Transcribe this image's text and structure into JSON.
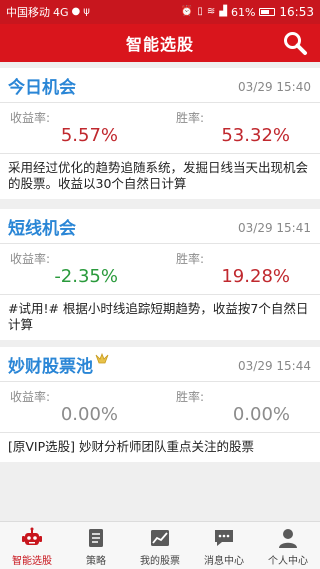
{
  "status_bar": {
    "carrier": "中国移动",
    "network": "4G",
    "battery": "61%",
    "time": "16:53"
  },
  "header": {
    "title": "智能选股",
    "search_icon": "search-icon"
  },
  "cards": [
    {
      "title": "今日机会",
      "time": "03/29 15:40",
      "return_label": "收益率:",
      "return_value": "5.57%",
      "winrate_label": "胜率:",
      "winrate_value": "53.32%",
      "description": "采用经过优化的趋势追随系统，发掘日线当天出现机会的股票。收益以30个自然日计算"
    },
    {
      "title": "短线机会",
      "time": "03/29 15:41",
      "return_label": "收益率:",
      "return_value": "-2.35%",
      "winrate_label": "胜率:",
      "winrate_value": "19.28%",
      "description": "#试用!# 根据小时线追踪短期趋势，收益按7个自然日计算"
    },
    {
      "title": "妙财股票池",
      "vip_icon": "vip-crown-icon",
      "time": "03/29 15:44",
      "return_label": "收益率:",
      "return_value": "0.00%",
      "winrate_label": "胜率:",
      "winrate_value": "0.00%",
      "description": "[原VIP选股] 妙财分析师团队重点关注的股票"
    }
  ],
  "tabs": [
    {
      "label": "智能选股",
      "icon": "robot-icon",
      "active": true
    },
    {
      "label": "策略",
      "icon": "document-icon",
      "active": false
    },
    {
      "label": "我的股票",
      "icon": "chart-icon",
      "active": false
    },
    {
      "label": "消息中心",
      "icon": "message-icon",
      "active": false
    },
    {
      "label": "个人中心",
      "icon": "person-icon",
      "active": false
    }
  ],
  "colors": {
    "brand_red": "#d9151c",
    "title_blue": "#2a86d6",
    "up_red": "#c0282e",
    "down_green": "#2a9a3c"
  }
}
